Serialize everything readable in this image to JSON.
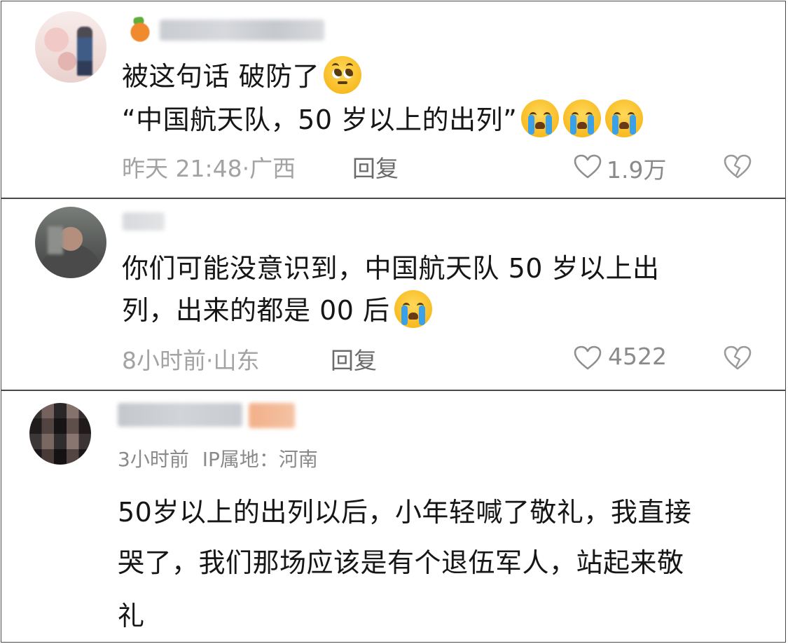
{
  "comments": [
    {
      "text_line1": "被这句话  破防了",
      "text_line2": "“中国航天队，50 岁以上的出列”",
      "time": "昨天 21:48",
      "location": "广西",
      "reply_label": "回复",
      "likes": "1.9万"
    },
    {
      "text_line1": "你们可能没意识到，中国航天队 50 岁以上出",
      "text_line2": "列，出来的都是 00 后",
      "time": "8小时前",
      "location": "山东",
      "reply_label": "回复",
      "likes": "4522"
    },
    {
      "time": "3小时前",
      "ip_label": "IP属地：",
      "location": "河南",
      "text_line1": "50岁以上的出列以后，小年轻喊了敬礼，我直接",
      "text_line2": "哭了，我们那场应该是有个退伍军人，站起来敬",
      "text_line3": "礼"
    }
  ],
  "separator": "·",
  "colors": {
    "text": "#161616",
    "meta": "#a3a3a3",
    "reply": "#6b6b6b",
    "border": "#4a4a4a",
    "emoji_face": "#f7b91f",
    "emoji_tear": "#3aa0e8"
  },
  "icons": {
    "like": "heart-outline-icon",
    "dislike": "broken-heart-icon",
    "emoji_cry": "loudly-crying-face-emoji",
    "emoji_plead": "pleading-face-emoji"
  }
}
